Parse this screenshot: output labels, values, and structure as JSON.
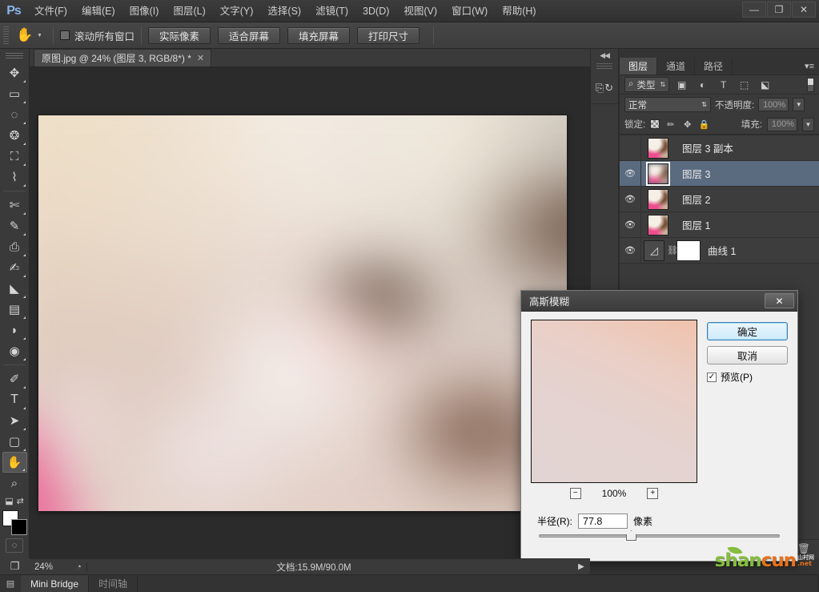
{
  "app": {
    "logo": "Ps",
    "menu": [
      {
        "label": "文件(F)"
      },
      {
        "label": "编辑(E)"
      },
      {
        "label": "图像(I)"
      },
      {
        "label": "图层(L)"
      },
      {
        "label": "文字(Y)"
      },
      {
        "label": "选择(S)"
      },
      {
        "label": "滤镜(T)"
      },
      {
        "label": "3D(D)"
      },
      {
        "label": "视图(V)"
      },
      {
        "label": "窗口(W)"
      },
      {
        "label": "帮助(H)"
      }
    ],
    "window_controls": {
      "minimize": "—",
      "restore": "❐",
      "close": "✕"
    }
  },
  "options_bar": {
    "active_tool_icon": "hand-tool",
    "scroll_all_windows_label": "滚动所有窗口",
    "scroll_all_windows_checked": false,
    "buttons": [
      {
        "label": "实际像素"
      },
      {
        "label": "适合屏幕"
      },
      {
        "label": "填充屏幕"
      },
      {
        "label": "打印尺寸"
      }
    ]
  },
  "toolbar": {
    "tools_top": [
      {
        "name": "move-tool",
        "glyph": "✥"
      },
      {
        "name": "marquee-tool",
        "glyph": "▭"
      },
      {
        "name": "lasso-tool",
        "glyph": "◯"
      },
      {
        "name": "quick-selection-tool",
        "glyph": "✧"
      },
      {
        "name": "crop-tool",
        "glyph": "⌗"
      },
      {
        "name": "eyedropper-tool",
        "glyph": "✎"
      }
    ],
    "tools_mid": [
      {
        "name": "healing-brush-tool",
        "glyph": "✂"
      },
      {
        "name": "brush-tool",
        "glyph": "✏"
      },
      {
        "name": "clone-stamp-tool",
        "glyph": "⎙"
      },
      {
        "name": "history-brush-tool",
        "glyph": "✒"
      },
      {
        "name": "eraser-tool",
        "glyph": "◣"
      },
      {
        "name": "gradient-tool",
        "glyph": "▬"
      },
      {
        "name": "blur-tool",
        "glyph": "💧"
      },
      {
        "name": "dodge-tool",
        "glyph": "◑"
      }
    ],
    "tools_bottom": [
      {
        "name": "pen-tool",
        "glyph": "✐"
      },
      {
        "name": "type-tool",
        "glyph": "T"
      },
      {
        "name": "path-selection-tool",
        "glyph": "➤"
      },
      {
        "name": "rectangle-tool",
        "glyph": "▢"
      },
      {
        "name": "hand-tool",
        "glyph": "✋",
        "selected": true
      },
      {
        "name": "zoom-tool",
        "glyph": "🔍"
      }
    ],
    "foreground_color": "#ffffff",
    "background_color": "#000000",
    "quick_mask_glyph": "◌"
  },
  "document": {
    "tab_label": "原图.jpg @ 24% (图层 3, RGB/8*) *",
    "close_glyph": "✕"
  },
  "layers_panel": {
    "tabs": [
      {
        "label": "图层",
        "active": true
      },
      {
        "label": "通道",
        "active": false
      },
      {
        "label": "路径",
        "active": false
      }
    ],
    "menu_glyph": "▾≡",
    "filter": {
      "search_glyph": "⌕",
      "kind_label": "类型",
      "caret": "⇅",
      "icons": [
        {
          "name": "filter-pixel-icon",
          "glyph": "▣"
        },
        {
          "name": "filter-adjustment-icon",
          "glyph": "◐"
        },
        {
          "name": "filter-type-icon",
          "glyph": "T"
        },
        {
          "name": "filter-shape-icon",
          "glyph": "⬚"
        },
        {
          "name": "filter-smart-object-icon",
          "glyph": "⬕"
        }
      ]
    },
    "blend_mode": "正常",
    "blend_caret": "⇅",
    "opacity_label": "不透明度:",
    "opacity_value": "100%",
    "lock_label": "锁定:",
    "lock_icons": [
      {
        "name": "lock-transparency-icon",
        "glyph": "▩"
      },
      {
        "name": "lock-image-icon",
        "glyph": "✏"
      },
      {
        "name": "lock-position-icon",
        "glyph": "✥"
      },
      {
        "name": "lock-all-icon",
        "glyph": "🔒"
      }
    ],
    "fill_label": "填充:",
    "fill_value": "100%",
    "eye_glyph": "👁",
    "layers": [
      {
        "name": "图层 3 副本",
        "visible": false,
        "selected": false,
        "type": "pixel"
      },
      {
        "name": "图层 3",
        "visible": true,
        "selected": true,
        "type": "pixel",
        "current": true
      },
      {
        "name": "图层 2",
        "visible": true,
        "selected": false,
        "type": "pixel"
      },
      {
        "name": "图层 1",
        "visible": true,
        "selected": false,
        "type": "pixel"
      },
      {
        "name": "曲线 1",
        "visible": true,
        "selected": false,
        "type": "adjustment",
        "link_glyph": "⛓"
      }
    ],
    "footer_icons": [
      {
        "name": "link-layers-icon",
        "glyph": "⛓"
      },
      {
        "name": "layer-style-fx-icon",
        "glyph": "fx"
      },
      {
        "name": "add-layer-mask-icon",
        "glyph": "◙"
      },
      {
        "name": "new-adjustment-layer-icon",
        "glyph": "◐"
      },
      {
        "name": "new-group-icon",
        "glyph": "🗀"
      },
      {
        "name": "new-layer-icon",
        "glyph": "❏"
      },
      {
        "name": "delete-layer-icon",
        "glyph": "🗑"
      }
    ]
  },
  "dock": {
    "collapse_glyph": "◀◀",
    "icons": [
      {
        "name": "history-panel-icon",
        "glyph": "⎘"
      },
      {
        "name": "mini-bridge-icon",
        "glyph": "↻"
      }
    ]
  },
  "dialog": {
    "title": "高斯模糊",
    "close_glyph": "✕",
    "ok_label": "确定",
    "cancel_label": "取消",
    "preview_label": "预览(P)",
    "preview_checked": true,
    "preview_check_glyph": "✓",
    "zoom_out_glyph": "−",
    "zoom_in_glyph": "+",
    "zoom_value": "100%",
    "radius_label": "半径(R):",
    "radius_value": "77.8",
    "radius_unit": "像素"
  },
  "status_bar": {
    "zoom": "24%",
    "zoom_icon": "◔",
    "doc_info": "文档:15.9M/90.0M",
    "play_glyph": "▶",
    "screen_mode_icon": "❐"
  },
  "bottom_tabs": [
    {
      "label": "Mini Bridge",
      "active": true
    },
    {
      "label": "时间轴",
      "active": false
    }
  ],
  "watermark": {
    "part1": "shan",
    "part2": "cun",
    "cn": "山村网",
    "net": ".net"
  }
}
